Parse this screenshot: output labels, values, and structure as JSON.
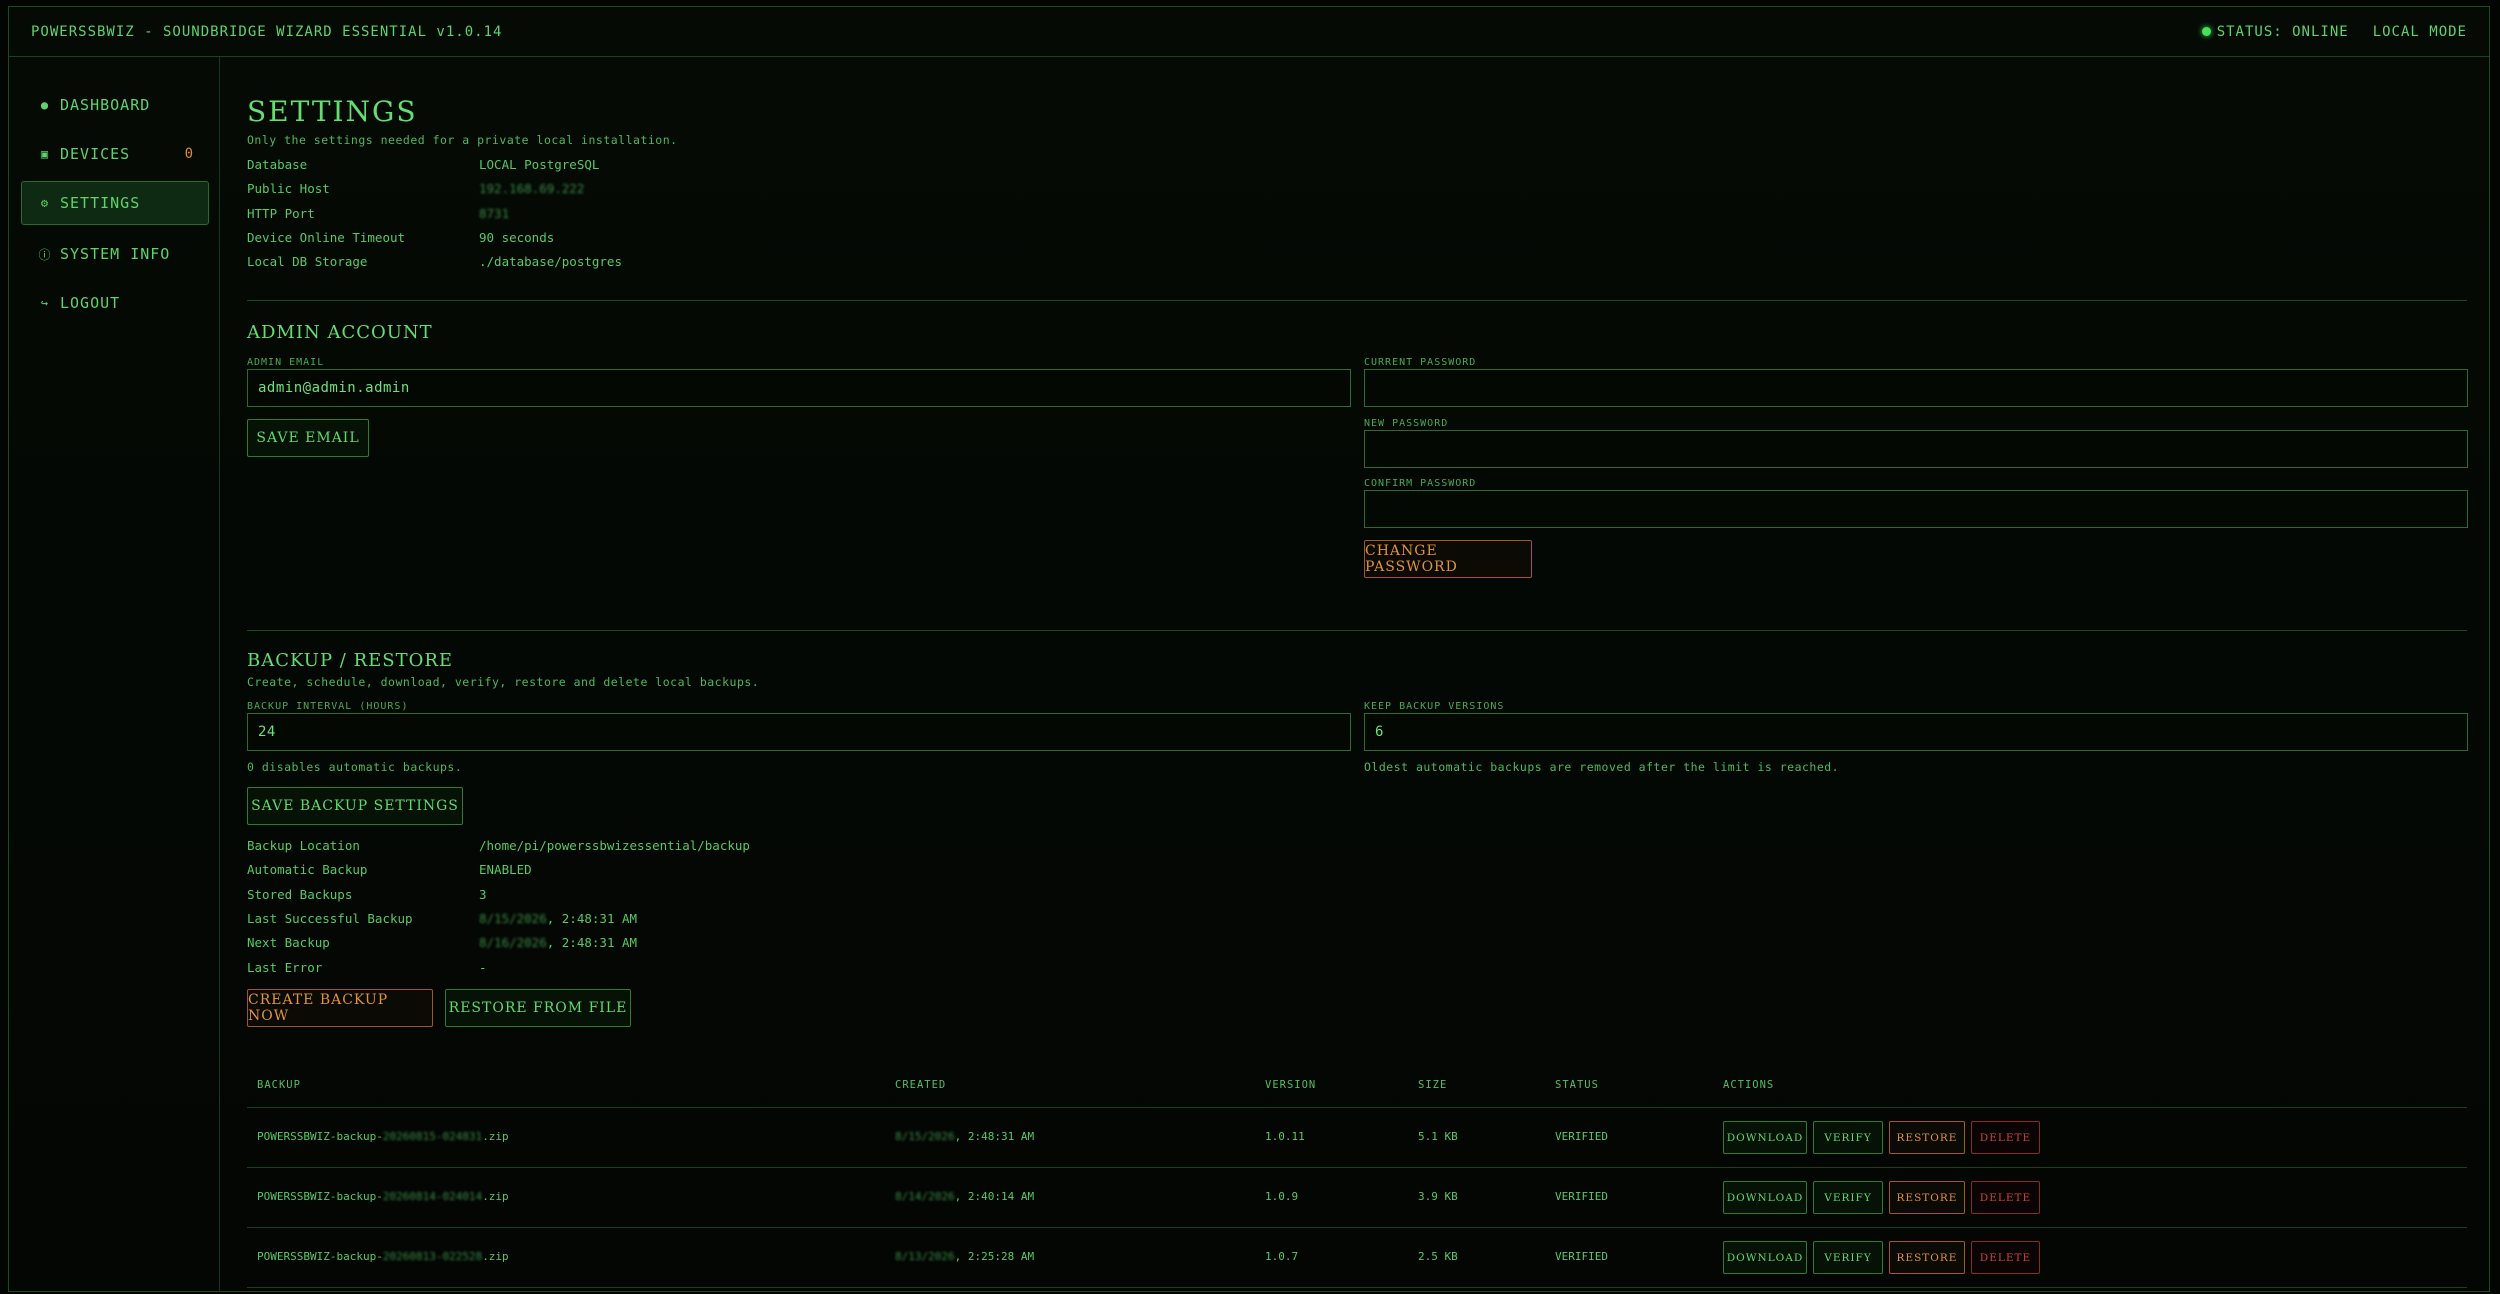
{
  "topbar": {
    "title": "POWERSSBWIZ - SOUNDBRIDGE WIZARD ESSENTIAL v1.0.14",
    "status": "STATUS: ONLINE",
    "mode": "LOCAL MODE"
  },
  "sidebar": {
    "items": [
      {
        "icon": "●",
        "label": "DASHBOARD"
      },
      {
        "icon": "▣",
        "label": "DEVICES",
        "count": "0"
      },
      {
        "icon": "⚙",
        "label": "SETTINGS"
      },
      {
        "icon": "ⓘ",
        "label": "SYSTEM INFO"
      },
      {
        "icon": "↪",
        "label": "LOGOUT"
      }
    ]
  },
  "settings": {
    "title": "SETTINGS",
    "subtitle": "Only the settings needed for a private local installation.",
    "info": [
      {
        "key": "Database",
        "value": "LOCAL PostgreSQL"
      },
      {
        "key": "Public Host",
        "value": "192.168.69.222"
      },
      {
        "key": "HTTP Port",
        "value": "8731"
      },
      {
        "key": "Device Online Timeout",
        "value": "90 seconds"
      },
      {
        "key": "Local DB Storage",
        "value": "./database/postgres"
      }
    ]
  },
  "admin": {
    "title": "ADMIN ACCOUNT",
    "email_label": "ADMIN EMAIL",
    "email_value": "admin@admin.admin",
    "save_email": "SAVE EMAIL",
    "current_password_label": "CURRENT PASSWORD",
    "new_password_label": "NEW PASSWORD",
    "confirm_password_label": "CONFIRM PASSWORD",
    "change_password": "CHANGE PASSWORD"
  },
  "backup": {
    "title": "BACKUP / RESTORE",
    "subtitle": "Create, schedule, download, verify, restore and delete local backups.",
    "interval_label": "BACKUP INTERVAL (HOURS)",
    "interval_value": "24",
    "interval_hint": "0 disables automatic backups.",
    "keep_label": "KEEP BACKUP VERSIONS",
    "keep_value": "6",
    "keep_hint": "Oldest automatic backups are removed after the limit is reached.",
    "save_settings": "SAVE BACKUP SETTINGS",
    "info": [
      {
        "key": "Backup Location",
        "value": "/home/pi/powerssbwizessential/backup"
      },
      {
        "key": "Automatic Backup",
        "value": "ENABLED"
      },
      {
        "key": "Stored Backups",
        "value": "3"
      },
      {
        "key": "Last Successful Backup",
        "value_blur": "8/15/2026",
        "value": ", 2:48:31 AM"
      },
      {
        "key": "Next Backup",
        "value_blur": "8/16/2026",
        "value": ", 2:48:31 AM"
      },
      {
        "key": "Last Error",
        "value": "-"
      }
    ],
    "create_now": "CREATE BACKUP NOW",
    "restore_file": "RESTORE FROM FILE",
    "table": {
      "headers": [
        "BACKUP",
        "CREATED",
        "VERSION",
        "SIZE",
        "STATUS",
        "ACTIONS"
      ],
      "rows": [
        {
          "prefix": "POWERSSBWIZ-backup-",
          "blur": "20260815-024831",
          "suffix": ".zip",
          "created_blur": "8/15/2026",
          "created": ", 2:48:31 AM",
          "version": "1.0.11",
          "size": "5.1 KB",
          "status": "VERIFIED"
        },
        {
          "prefix": "POWERSSBWIZ-backup-",
          "blur": "20260814-024014",
          "suffix": ".zip",
          "created_blur": "8/14/2026",
          "created": ", 2:40:14 AM",
          "version": "1.0.9",
          "size": "3.9 KB",
          "status": "VERIFIED"
        },
        {
          "prefix": "POWERSSBWIZ-backup-",
          "blur": "20260813-022528",
          "suffix": ".zip",
          "created_blur": "8/13/2026",
          "created": ", 2:25:28 AM",
          "version": "1.0.7",
          "size": "2.5 KB",
          "status": "VERIFIED"
        }
      ],
      "actions": [
        "DOWNLOAD",
        "VERIFY",
        "RESTORE",
        "DELETE"
      ]
    }
  }
}
